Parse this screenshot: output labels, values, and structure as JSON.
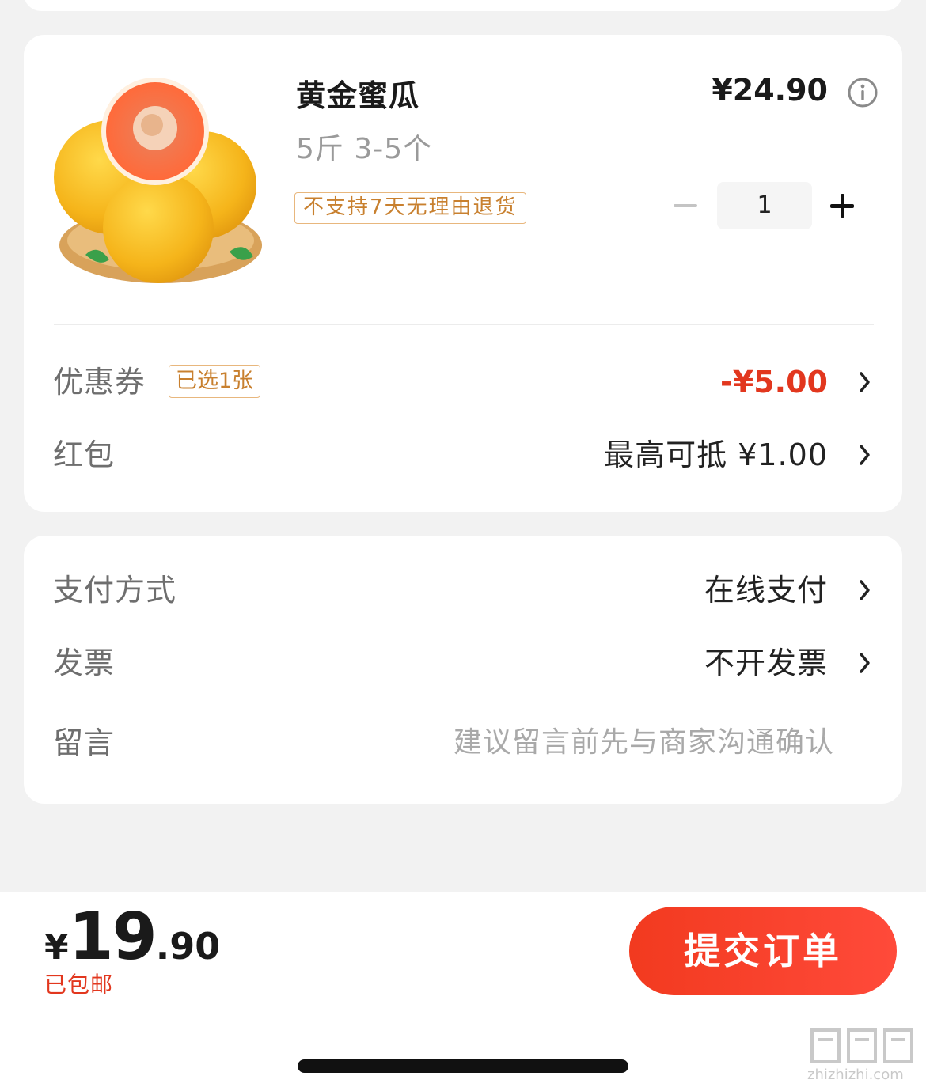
{
  "product": {
    "name": "黄金蜜瓜",
    "spec": "5斤 3-5个",
    "tag": "不支持7天无理由退货",
    "price": "¥24.90",
    "quantity": "1"
  },
  "discounts": {
    "coupon_label": "优惠券",
    "coupon_tag": "已选1张",
    "coupon_value": "-¥5.00",
    "redpacket_label": "红包",
    "redpacket_value": "最高可抵 ¥1.00"
  },
  "options": {
    "payment_label": "支付方式",
    "payment_value": "在线支付",
    "invoice_label": "发票",
    "invoice_value": "不开发票",
    "note_label": "留言",
    "note_placeholder": "建议留言前先与商家沟通确认"
  },
  "footer": {
    "currency": "¥",
    "total_int": "19",
    "total_dec": ".90",
    "shipping": "已包邮",
    "submit_label": "提交订单"
  },
  "watermark": {
    "site": "zhizhizhi.com"
  },
  "colors": {
    "accent_red": "#e2371e",
    "tag_orange": "#c8802f",
    "background": "#f2f2f2"
  }
}
